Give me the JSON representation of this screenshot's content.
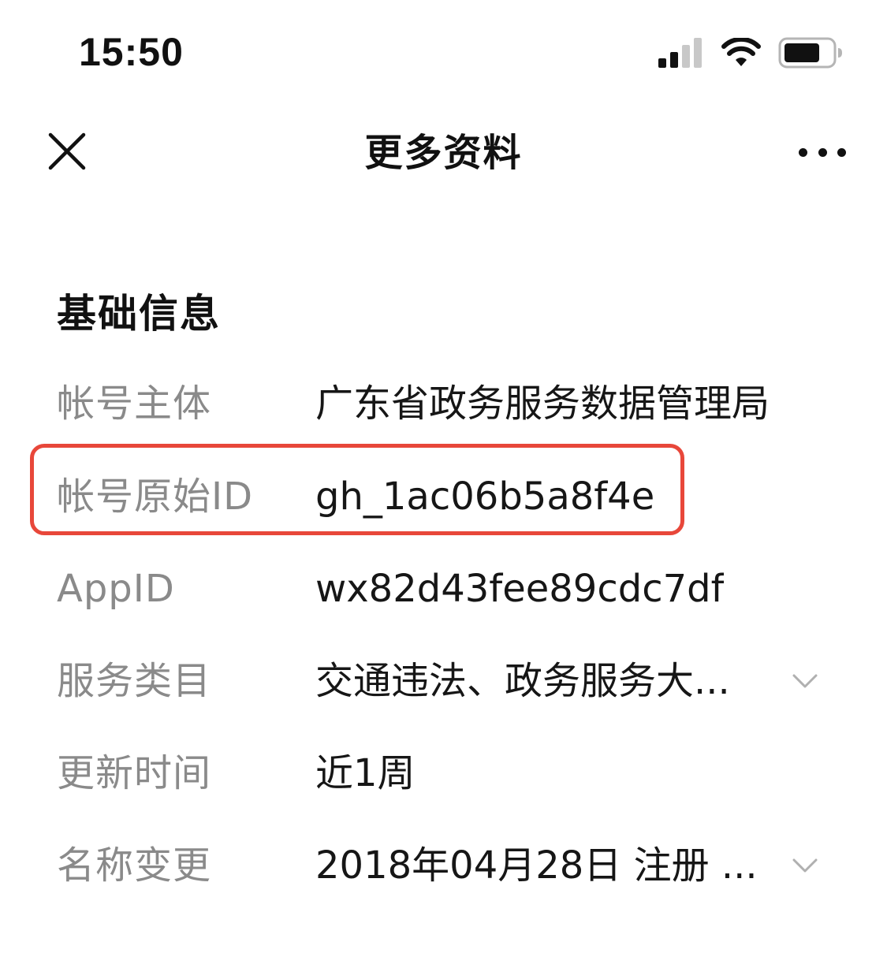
{
  "status_bar": {
    "time": "15:50",
    "icons": [
      "cellular-signal-icon",
      "wifi-icon",
      "battery-icon"
    ]
  },
  "nav": {
    "close_icon": "close-icon",
    "title": "更多资料",
    "more_icon": "more-icon"
  },
  "section": {
    "title": "基础信息"
  },
  "rows": [
    {
      "label": "帐号主体",
      "value": "广东省政务服务数据管理局"
    },
    {
      "label": "帐号原始ID",
      "value": "gh_1ac06b5a8f4e",
      "highlighted": true
    },
    {
      "label": "AppID",
      "value": "wx82d43fee89cdc7df"
    },
    {
      "label": "服务类目",
      "value": "交通违法、政务服务大...",
      "expandable": true
    },
    {
      "label": "更新时间",
      "value": "近1周"
    },
    {
      "label": "名称变更",
      "value": "2018年04月28日 注册 ...",
      "expandable": true
    }
  ],
  "colors": {
    "highlight_border": "#e8473a",
    "label_text": "#8a8a8a",
    "value_text": "#161616"
  }
}
